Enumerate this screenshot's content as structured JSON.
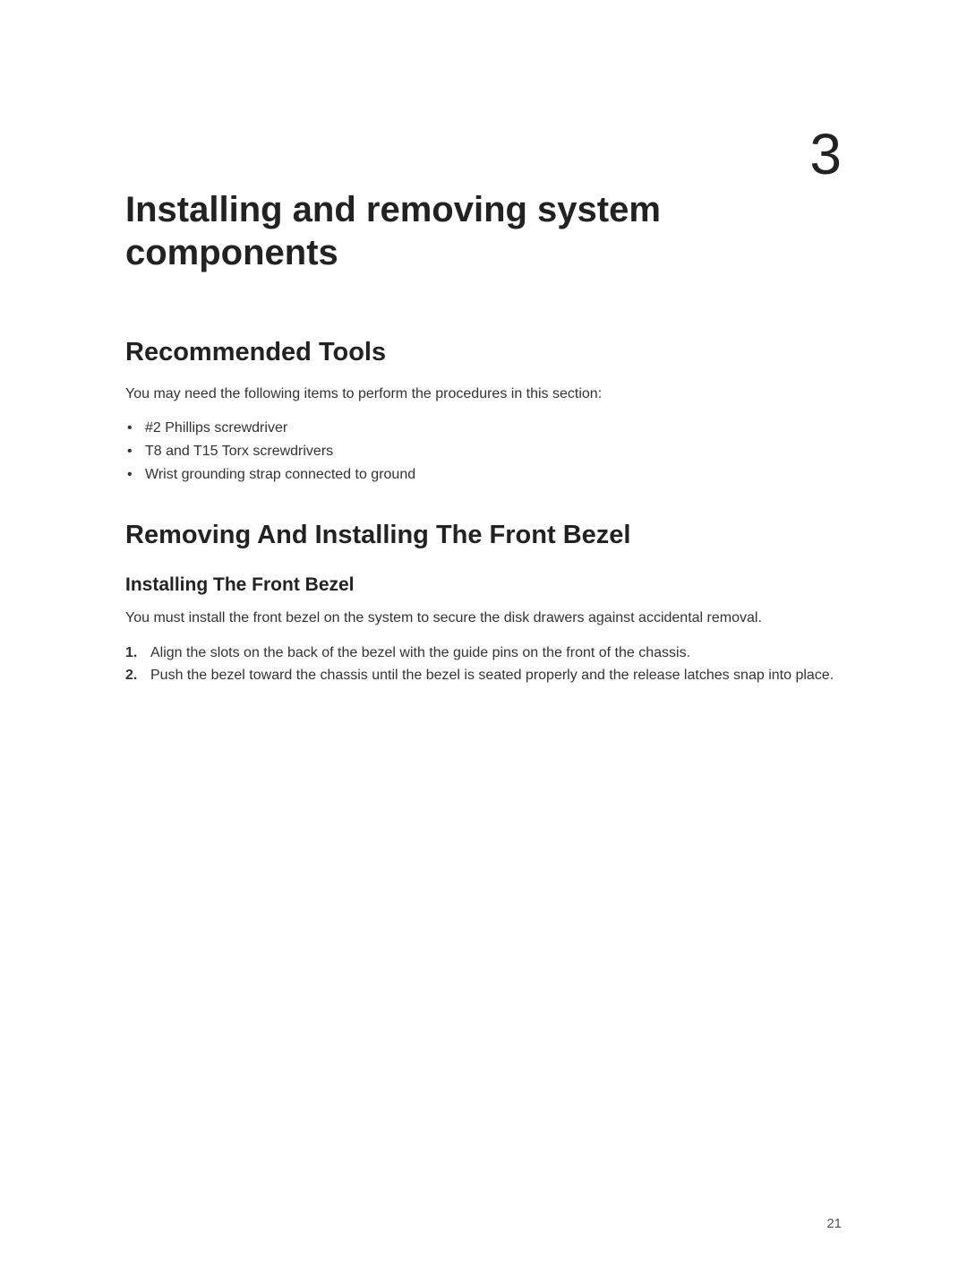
{
  "chapter": {
    "number": "3"
  },
  "title": "Installing and removing system components",
  "sections": {
    "tools": {
      "heading": "Recommended Tools",
      "intro": "You may need the following items to perform the procedures in this section:",
      "items": [
        "#2 Phillips screwdriver",
        "T8 and T15 Torx screwdrivers",
        "Wrist grounding strap connected to ground"
      ]
    },
    "bezel": {
      "heading": "Removing And Installing The Front Bezel",
      "sub": {
        "heading": "Installing The Front Bezel",
        "intro": "You must install the front bezel on the system to secure the disk drawers against accidental removal.",
        "steps": [
          "Align the slots on the back of the bezel with the guide pins on the front of the chassis.",
          "Push the bezel toward the chassis until the bezel is seated properly and the release latches snap into place."
        ]
      }
    }
  },
  "pageNumber": "21"
}
